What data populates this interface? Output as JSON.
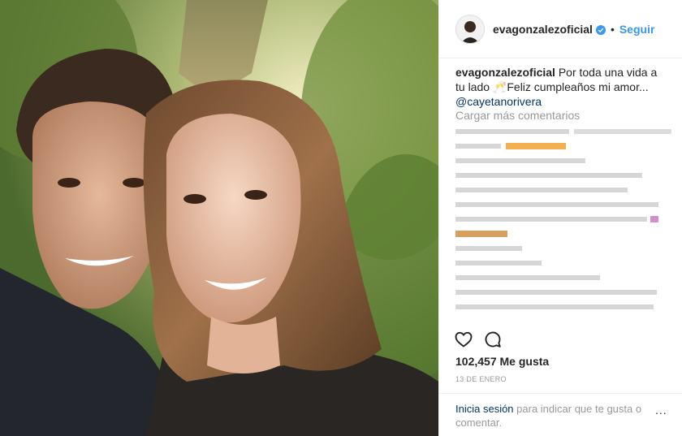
{
  "post": {
    "username": "evagonzalezoficial",
    "follow_label": "Seguir",
    "separator": "•",
    "caption_username": "evagonzalezoficial",
    "caption_text": "Por toda una vida a tu lado 🥂Feliz cumpleaños mi amor...",
    "caption_mention": "@cayetanorivera",
    "load_more_label": "Cargar más comentarios",
    "likes": "102,457 Me gusta",
    "date": "13 DE ENERO"
  },
  "footer": {
    "login_link": "Inicia sesión",
    "login_text": " para indicar que te gusta o comentar.",
    "options_label": "..."
  },
  "icons": {
    "like": "heart-icon",
    "comment": "comment-icon",
    "verified": "verified-badge-icon"
  },
  "colors": {
    "link": "#3897f0",
    "mention": "#003569",
    "muted": "#999999"
  }
}
